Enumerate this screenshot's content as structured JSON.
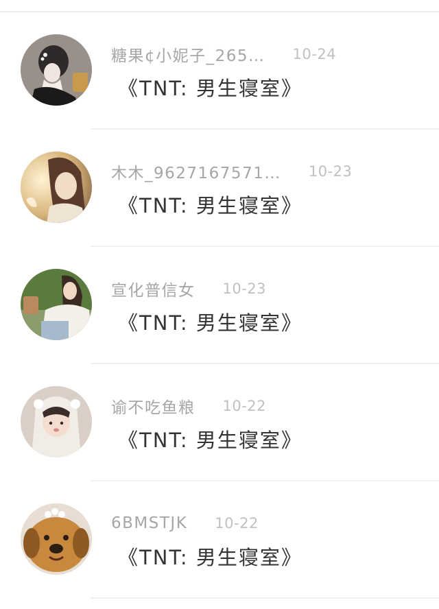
{
  "items": [
    {
      "username": "糖果¢小妮子_265…",
      "date": "10-24",
      "message": "《TNT: 男生寝室》",
      "avatar_icon": "woman-with-hair-clip-avatar"
    },
    {
      "username": "木木_9627167571…",
      "date": "10-23",
      "message": "《TNT: 男生寝室》",
      "avatar_icon": "woman-in-warm-light-avatar"
    },
    {
      "username": "宣化普信女",
      "date": "10-23",
      "message": "《TNT: 男生寝室》",
      "avatar_icon": "woman-sitting-outdoors-avatar"
    },
    {
      "username": "谕不吃鱼粮",
      "date": "10-22",
      "message": "《TNT: 男生寝室》",
      "avatar_icon": "child-in-hood-avatar"
    },
    {
      "username": "6BMSTJK",
      "date": "10-22",
      "message": "《TNT: 男生寝室》",
      "avatar_icon": "dog-face-avatar"
    }
  ]
}
